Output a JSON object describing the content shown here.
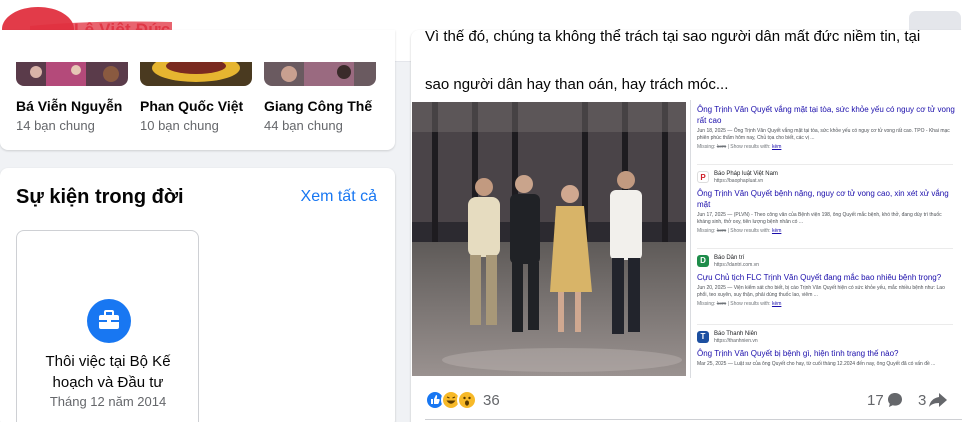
{
  "header": {
    "profile_name": "Lê Việt Đức",
    "more_icon": "more-horizontal-icon"
  },
  "friends": [
    {
      "name": "Bá Viễn Nguyễn",
      "mutual": "14 bạn chung"
    },
    {
      "name": "Phan Quốc Việt",
      "mutual": "10 bạn chung"
    },
    {
      "name": "Giang Công Thế",
      "mutual": "44 bạn chung"
    }
  ],
  "life_events": {
    "title": "Sự kiện trong đời",
    "see_all": "Xem tất cả",
    "event": {
      "icon": "briefcase-icon",
      "title": "Thôi việc tại Bộ Kế hoạch và Đầu tư",
      "date": "Tháng 12 năm 2014"
    }
  },
  "post": {
    "text_line1_partial": "Vì thế đó, chúng ta không thể trách tại sao người dân mất đức niềm tin, tại",
    "text_line2": "sao người dân hay than oán, hay trách móc...",
    "search_results": [
      {
        "source": "",
        "url": "",
        "title": "Ông Trịnh Văn Quyết vắng mặt tại tòa, sức khỏe yếu có nguy cơ tử vong rất cao",
        "snippet": "Jun 18, 2025 — Ông Trịnh Văn Quyết vắng mặt tại tòa, sức khỏe yếu có nguy cơ tử vong rất cao. TPO - Khai mạc phiên phúc thẩm hôm nay, Chủ tọa cho biết, các vị ...",
        "missing": "kem",
        "show_results": "kèm"
      },
      {
        "source": "Báo Pháp luật Việt Nam",
        "url": "https://baophapluat.vn",
        "title": "Ông Trịnh Văn Quyết bệnh nặng, nguy cơ tử vong cao, xin xét xử vắng mặt",
        "snippet": "Jun 17, 2025 — (PLVN) - Theo công văn của Bệnh viện 198, ông Quyết mắc bệnh, khó thở, đang dùy trì thuốc kháng sinh, thở oxy, tiên lượng bệnh nhân có ...",
        "missing": "kem",
        "show_results": "kèm"
      },
      {
        "source": "Báo Dân trí",
        "url": "https://dantri.com.vn",
        "title": "Cựu Chủ tịch FLC Trịnh Văn Quyết đang mắc bao nhiêu bệnh trọng?",
        "snippet": "Jun 20, 2025 — Viện kiểm sát cho biết, bị cáo Trịnh Văn Quyết hiện có sức khỏe yếu, mắc nhiều bệnh như: Lao phổi, teo xuyên, suy thận, phải dùng thuốc lao, viêm ...",
        "missing": "kem",
        "show_results": "kèm"
      },
      {
        "source": "Báo Thanh Niên",
        "url": "https://thanhnien.vn",
        "title": "Ông Trịnh Văn Quyết bị bệnh gì, hiện tình trạng thế nào?",
        "snippet": "Mar 25, 2025 — Luật sư của ông Quyết cho hay, từ cuối tháng 12.2024 đến nay, ông Quyết đã có vấn đề ...",
        "missing": "",
        "show_results": ""
      }
    ],
    "missing_label": "Missing:",
    "show_results_label": "Show results with:",
    "reactions": {
      "icons": [
        "like-reaction-icon",
        "haha-reaction-icon",
        "wow-reaction-icon"
      ],
      "count": "36"
    },
    "comments_count": "17",
    "shares_count": "3"
  },
  "colors": {
    "accent": "#1877f2",
    "name_redacted": "#e0303f",
    "page_bg": "#f0f2f5"
  }
}
